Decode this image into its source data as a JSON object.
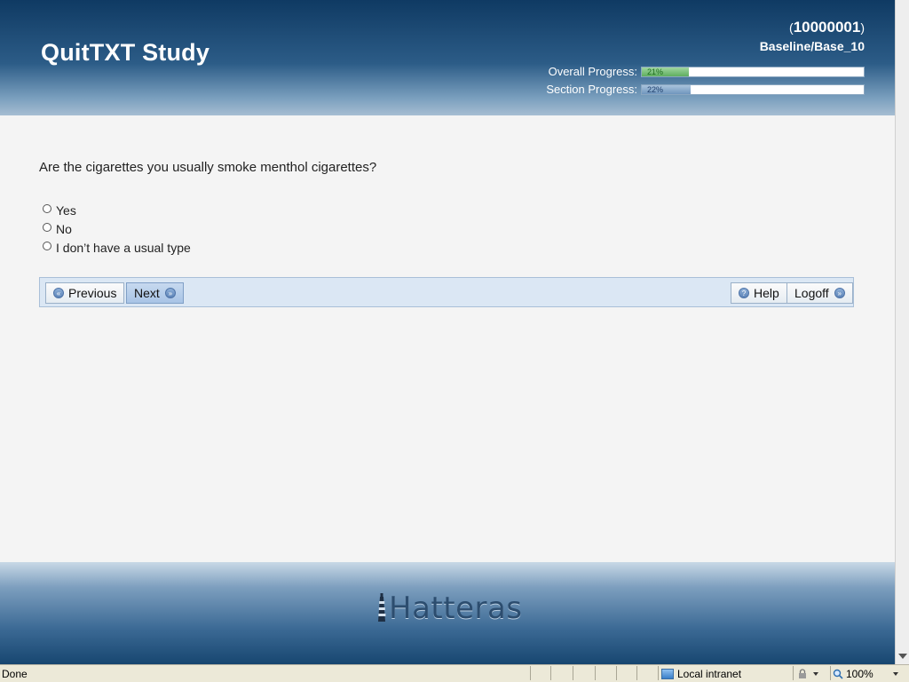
{
  "header": {
    "title": "QuitTXT Study",
    "participant_id": "10000001",
    "paren_open": "(",
    "paren_close": ")",
    "step": "Baseline/Base_10",
    "overall_label": "Overall Progress:",
    "overall_value": 0.21,
    "overall_text": "21%",
    "section_label": "Section Progress:",
    "section_value": 0.22,
    "section_text": "22%"
  },
  "question": {
    "text": "Are the cigarettes you usually smoke menthol cigarettes?",
    "options": [
      "Yes",
      "No",
      "I don’t have a usual type"
    ]
  },
  "nav": {
    "previous": "Previous",
    "next": "Next",
    "help": "Help",
    "logoff": "Logoff"
  },
  "footer": {
    "logo": "Hatteras"
  },
  "statusbar": {
    "status": "Done",
    "zone": "Local intranet",
    "zoom": "100%"
  },
  "colors": {
    "header_top": "#0f3a63",
    "overall_fill": "#5fae5f",
    "section_fill": "#6f96bd",
    "nav_bg": "#dbe7f4"
  },
  "icons": [
    "previous-arrow-icon",
    "next-arrow-icon",
    "help-icon",
    "logoff-arrow-icon",
    "lighthouse-icon",
    "globe-icon",
    "lock-icon",
    "zoom-icon"
  ]
}
